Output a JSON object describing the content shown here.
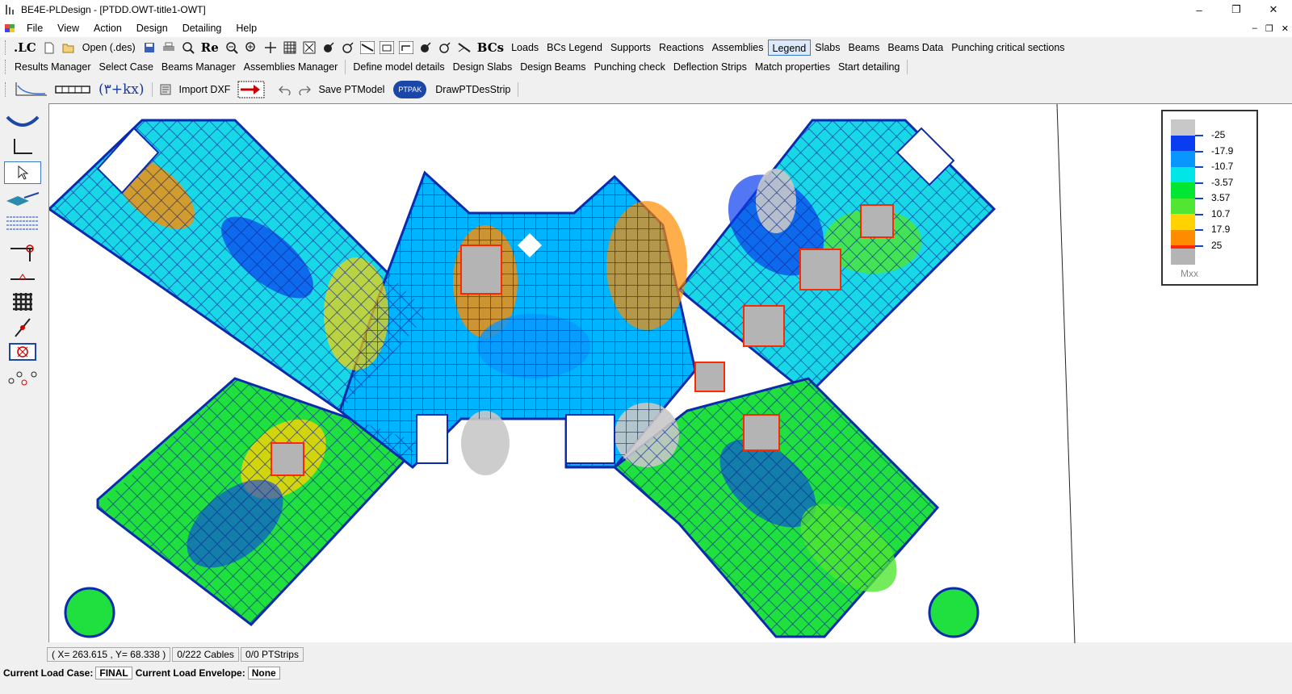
{
  "window": {
    "title": "BE4E-PLDesign - [PTDD.OWT-title1-OWT]",
    "minimize": "–",
    "maximize": "❐",
    "close": "✕"
  },
  "menu": {
    "items": [
      "File",
      "View",
      "Action",
      "Design",
      "Detailing",
      "Help"
    ]
  },
  "toolbar1": {
    "lc_label": ".LC",
    "open_label": "Open (.des)",
    "re_label": "Re",
    "bcs_label": "BCs",
    "buttons": [
      "Loads",
      "BCs Legend",
      "Supports",
      "Reactions",
      "Assemblies",
      "Legend",
      "Slabs",
      "Beams",
      "Beams Data",
      "Punching critical sections"
    ],
    "active_button": "Legend"
  },
  "toolbar2": {
    "buttons": [
      "Results Manager",
      "Select Case",
      "Beams Manager",
      "Assemblies Manager",
      "Define model details",
      "Design Slabs",
      "Design Beams",
      "Punching check",
      "Deflection Strips",
      "Match properties",
      "Start detailing"
    ]
  },
  "toolbar3": {
    "formula_label": "(۳+kx)",
    "import_label": "Import DXF",
    "save_label": "Save PTModel",
    "ptpak_label": "PTPAK",
    "draw_label": "DrawPTDesStrip"
  },
  "legend": {
    "name": "Mxx",
    "values": [
      "-25",
      "-17.9",
      "-10.7",
      "-3.57",
      "3.57",
      "10.7",
      "17.9",
      "25"
    ],
    "colors": [
      "#c8c8c8",
      "#0a3cf0",
      "#0a96ff",
      "#00e6e6",
      "#00e632",
      "#50e632",
      "#ffd200",
      "#ff8c00",
      "#ff2800",
      "#b4b4b4"
    ]
  },
  "status": {
    "coords": "( X= 263.615 , Y= 68.338 )",
    "cables": "0/222 Cables",
    "strips": "0/0 PTStrips"
  },
  "loadbar": {
    "case_label": "Current Load Case:",
    "case_value": "FINAL",
    "envelope_label": "Current Load Envelope:",
    "envelope_value": "None"
  }
}
